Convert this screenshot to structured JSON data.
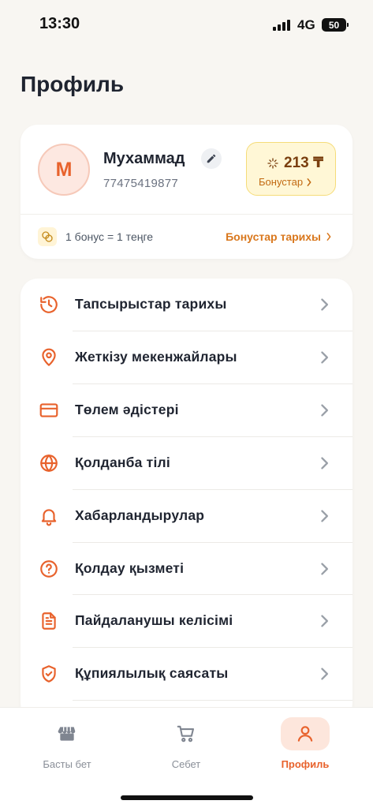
{
  "status_bar": {
    "time": "13:30",
    "network": "4G",
    "battery": "50"
  },
  "page": {
    "title": "Профиль"
  },
  "profile": {
    "avatar_initial": "М",
    "name": "Мухаммад",
    "phone": "77475419877",
    "bonus_amount": "213 ₸",
    "bonus_link": "Бонустар",
    "bonus_rate": "1 бонус = 1 теңге",
    "bonus_history": "Бонустар тарихы"
  },
  "menu": {
    "items": [
      {
        "label": "Тапсырыстар тарихы",
        "icon": "history-icon"
      },
      {
        "label": "Жеткізу мекенжайлары",
        "icon": "location-pin-icon"
      },
      {
        "label": "Төлем әдістері",
        "icon": "credit-card-icon"
      },
      {
        "label": "Қолданба тілі",
        "icon": "globe-icon"
      },
      {
        "label": "Хабарландырулар",
        "icon": "bell-icon"
      },
      {
        "label": "Қолдау қызметі",
        "icon": "help-circle-icon"
      },
      {
        "label": "Пайдаланушы келісімі",
        "icon": "document-icon"
      },
      {
        "label": "Құпиялылық саясаты",
        "icon": "shield-check-icon"
      }
    ]
  },
  "tabs": [
    {
      "label": "Басты бет",
      "icon": "store-icon",
      "active": false
    },
    {
      "label": "Себет",
      "icon": "cart-icon",
      "active": false
    },
    {
      "label": "Профиль",
      "icon": "user-icon",
      "active": true
    }
  ],
  "colors": {
    "accent": "#E8622C",
    "bonus_bg": "#FFF7D6",
    "bonus_text": "#7A3F0F",
    "link": "#D9771C"
  }
}
